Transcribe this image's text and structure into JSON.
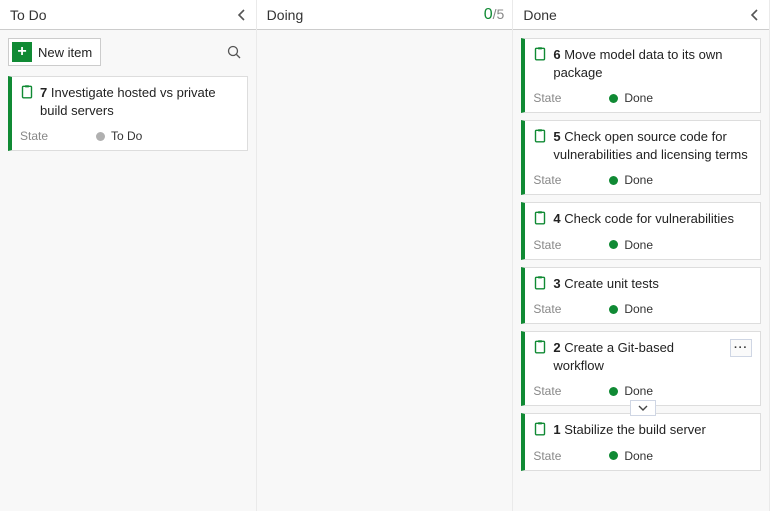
{
  "columns": {
    "todo": {
      "title": "To Do"
    },
    "doing": {
      "title": "Doing",
      "wip_current": "0",
      "wip_limit": "5"
    },
    "done": {
      "title": "Done"
    }
  },
  "newitem_label": "New item",
  "field_labels": {
    "state": "State"
  },
  "states": {
    "todo": "To Do",
    "done": "Done"
  },
  "todo_cards": [
    {
      "id": "7",
      "title": "Investigate hosted vs private build servers",
      "state": "todo"
    }
  ],
  "done_cards": [
    {
      "id": "6",
      "title": "Move model data to its own package",
      "state": "done"
    },
    {
      "id": "5",
      "title": "Check open source code for vulnerabilities and licensing terms",
      "state": "done"
    },
    {
      "id": "4",
      "title": "Check code for vulnerabilities",
      "state": "done"
    },
    {
      "id": "3",
      "title": "Create unit tests",
      "state": "done"
    },
    {
      "id": "2",
      "title": "Create a Git-based workflow",
      "state": "done",
      "show_menu": true,
      "show_expand": true
    },
    {
      "id": "1",
      "title": "Stabilize the build server",
      "state": "done"
    }
  ]
}
